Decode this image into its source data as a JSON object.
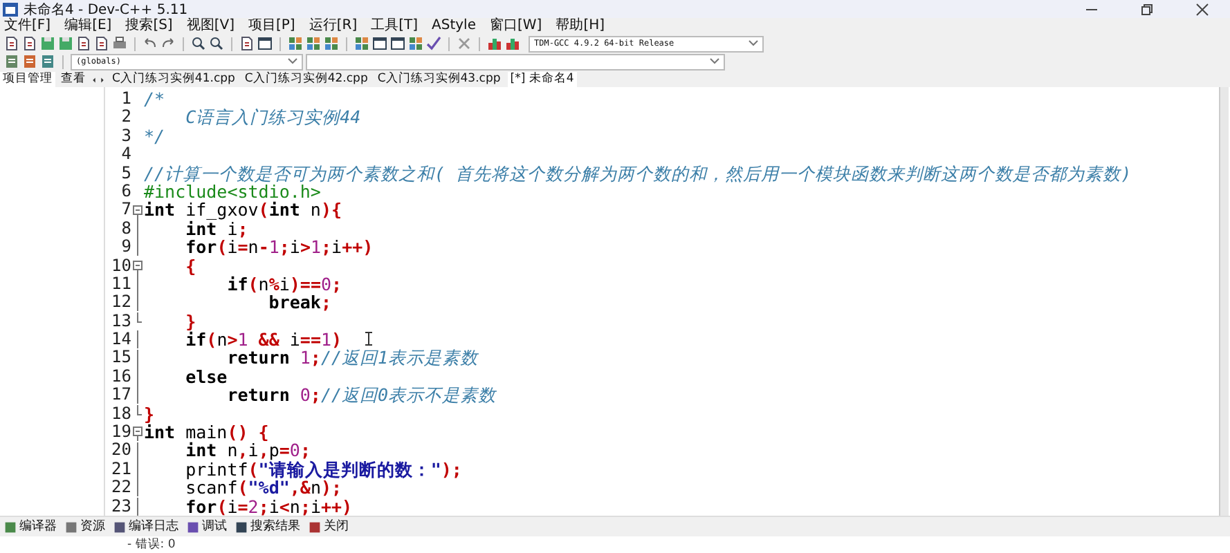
{
  "window": {
    "title": "未命名4 - Dev-C++ 5.11"
  },
  "menu": [
    "文件[F]",
    "编辑[E]",
    "搜索[S]",
    "视图[V]",
    "项目[P]",
    "运行[R]",
    "工具[T]",
    "AStyle",
    "窗口[W]",
    "帮助[H]"
  ],
  "compiler_select": {
    "value": "TDM-GCC 4.9.2 64-bit Release"
  },
  "scope_select": {
    "value": "(globals)"
  },
  "side_tabs": [
    {
      "label": "项目管理",
      "selected": true
    },
    {
      "label": "查看",
      "selected": false
    }
  ],
  "file_tabs": [
    {
      "label": "C入门练习实例41.cpp",
      "selected": false
    },
    {
      "label": "C入门练习实例42.cpp",
      "selected": false
    },
    {
      "label": "C入门练习实例43.cpp",
      "selected": false
    },
    {
      "label": "[*] 未命名4",
      "selected": true
    }
  ],
  "editor": {
    "lines": [
      {
        "number": "1",
        "kind": "plain",
        "tokens": [
          {
            "kind": "comment",
            "text": "/*"
          }
        ]
      },
      {
        "number": "2",
        "kind": "plain",
        "tokens": [
          {
            "kind": "comment",
            "text": "    C语言入门练习实例44"
          }
        ]
      },
      {
        "number": "3",
        "kind": "plain",
        "tokens": [
          {
            "kind": "comment",
            "text": "*/"
          }
        ]
      },
      {
        "number": "4",
        "kind": "plain"
      },
      {
        "number": "5",
        "kind": "plain",
        "tokens": [
          {
            "kind": "comment",
            "text": "//计算一个数是否可为两个素数之和( 首先将这个数分解为两个数的和，然后用一个模块函数来判断这两个数是否都为素数)"
          }
        ]
      },
      {
        "number": "6",
        "kind": "plain",
        "tokens": [
          {
            "kind": "preprocessor",
            "text": "#include<stdio.h>"
          }
        ]
      },
      {
        "number": "7",
        "kind": "start",
        "tokens": [
          {
            "kind": "keyword",
            "text": "int"
          },
          {
            "kind": "ident",
            "text": " if_gxov"
          },
          {
            "kind": "symbol",
            "text": "("
          },
          {
            "kind": "keyword",
            "text": "int"
          },
          {
            "kind": "ident",
            "text": " n"
          },
          {
            "kind": "symbol",
            "text": "){"
          }
        ]
      },
      {
        "number": "8",
        "kind": "body",
        "tokens": [
          {
            "kind": "keyword",
            "text": "    int"
          },
          {
            "kind": "ident",
            "text": " i"
          },
          {
            "kind": "symbol",
            "text": ";"
          }
        ]
      },
      {
        "number": "9",
        "kind": "body",
        "tokens": [
          {
            "kind": "keyword",
            "text": "    for"
          },
          {
            "kind": "symbol",
            "text": "("
          },
          {
            "kind": "ident",
            "text": "i"
          },
          {
            "kind": "symbol",
            "text": "="
          },
          {
            "kind": "ident",
            "text": "n"
          },
          {
            "kind": "symbol",
            "text": "-"
          },
          {
            "kind": "number",
            "text": "1"
          },
          {
            "kind": "symbol",
            "text": ";"
          },
          {
            "kind": "ident",
            "text": "i"
          },
          {
            "kind": "symbol",
            "text": ">"
          },
          {
            "kind": "number",
            "text": "1"
          },
          {
            "kind": "symbol",
            "text": ";"
          },
          {
            "kind": "ident",
            "text": "i"
          },
          {
            "kind": "symbol",
            "text": "++)"
          }
        ]
      },
      {
        "number": "10",
        "kind": "start",
        "tokens": [
          {
            "kind": "symbol",
            "text": "    {"
          }
        ]
      },
      {
        "number": "11",
        "kind": "body",
        "tokens": [
          {
            "kind": "keyword",
            "text": "        if"
          },
          {
            "kind": "symbol",
            "text": "("
          },
          {
            "kind": "ident",
            "text": "n"
          },
          {
            "kind": "symbol",
            "text": "%"
          },
          {
            "kind": "ident",
            "text": "i"
          },
          {
            "kind": "symbol",
            "text": ")=="
          },
          {
            "kind": "number",
            "text": "0"
          },
          {
            "kind": "symbol",
            "text": ";"
          }
        ]
      },
      {
        "number": "12",
        "kind": "body",
        "tokens": [
          {
            "kind": "keyword",
            "text": "            break"
          },
          {
            "kind": "symbol",
            "text": ";"
          }
        ]
      },
      {
        "number": "13",
        "kind": "end",
        "tokens": [
          {
            "kind": "symbol",
            "text": "    }"
          }
        ]
      },
      {
        "number": "14",
        "kind": "body",
        "tokens": [
          {
            "kind": "keyword",
            "text": "    if"
          },
          {
            "kind": "symbol",
            "text": "("
          },
          {
            "kind": "ident",
            "text": "n"
          },
          {
            "kind": "symbol",
            "text": ">"
          },
          {
            "kind": "number",
            "text": "1"
          },
          {
            "kind": "symbol",
            "text": " && "
          },
          {
            "kind": "ident",
            "text": "i"
          },
          {
            "kind": "symbol",
            "text": "=="
          },
          {
            "kind": "number",
            "text": "1"
          },
          {
            "kind": "symbol",
            "text": ")"
          }
        ]
      },
      {
        "number": "15",
        "kind": "body",
        "tokens": [
          {
            "kind": "keyword",
            "text": "        return"
          },
          {
            "kind": "number",
            "text": " 1"
          },
          {
            "kind": "symbol",
            "text": ";"
          },
          {
            "kind": "comment",
            "text": "//返回1表示是素数"
          }
        ]
      },
      {
        "number": "16",
        "kind": "body",
        "tokens": [
          {
            "kind": "keyword",
            "text": "    else"
          }
        ]
      },
      {
        "number": "17",
        "kind": "body",
        "tokens": [
          {
            "kind": "keyword",
            "text": "        return"
          },
          {
            "kind": "number",
            "text": " 0"
          },
          {
            "kind": "symbol",
            "text": ";"
          },
          {
            "kind": "comment",
            "text": "//返回0表示不是素数"
          }
        ]
      },
      {
        "number": "18",
        "kind": "end",
        "tokens": [
          {
            "kind": "symbol",
            "text": "}"
          }
        ]
      },
      {
        "number": "19",
        "kind": "start",
        "tokens": [
          {
            "kind": "keyword",
            "text": "int"
          },
          {
            "kind": "ident",
            "text": " main"
          },
          {
            "kind": "symbol",
            "text": "() {"
          }
        ]
      },
      {
        "number": "20",
        "kind": "body",
        "tokens": [
          {
            "kind": "keyword",
            "text": "    int"
          },
          {
            "kind": "ident",
            "text": " n"
          },
          {
            "kind": "symbol",
            "text": ","
          },
          {
            "kind": "ident",
            "text": "i"
          },
          {
            "kind": "symbol",
            "text": ","
          },
          {
            "kind": "ident",
            "text": "p"
          },
          {
            "kind": "symbol",
            "text": "="
          },
          {
            "kind": "number",
            "text": "0"
          },
          {
            "kind": "symbol",
            "text": ";"
          }
        ]
      },
      {
        "number": "21",
        "kind": "body",
        "tokens": [
          {
            "kind": "ident",
            "text": "    printf"
          },
          {
            "kind": "symbol",
            "text": "("
          },
          {
            "kind": "string",
            "text": "\"请输入是判断的数：\""
          },
          {
            "kind": "symbol",
            "text": ");"
          }
        ]
      },
      {
        "number": "22",
        "kind": "body",
        "tokens": [
          {
            "kind": "ident",
            "text": "    scanf"
          },
          {
            "kind": "symbol",
            "text": "("
          },
          {
            "kind": "string",
            "text": "\"%d\""
          },
          {
            "kind": "symbol",
            "text": ",&"
          },
          {
            "kind": "ident",
            "text": "n"
          },
          {
            "kind": "symbol",
            "text": ");"
          }
        ]
      },
      {
        "number": "23",
        "kind": "body",
        "tokens": [
          {
            "kind": "keyword",
            "text": "    for"
          },
          {
            "kind": "symbol",
            "text": "("
          },
          {
            "kind": "ident",
            "text": "i"
          },
          {
            "kind": "symbol",
            "text": "="
          },
          {
            "kind": "number",
            "text": "2"
          },
          {
            "kind": "symbol",
            "text": ";"
          },
          {
            "kind": "ident",
            "text": "i"
          },
          {
            "kind": "symbol",
            "text": "<"
          },
          {
            "kind": "ident",
            "text": "n"
          },
          {
            "kind": "symbol",
            "text": ";"
          },
          {
            "kind": "ident",
            "text": "i"
          },
          {
            "kind": "symbol",
            "text": "++)"
          }
        ]
      }
    ]
  },
  "bottom_tabs": [
    "编译器",
    "资源",
    "编译日志",
    "调试",
    "搜索结果",
    "关闭"
  ],
  "log_line": "- 错误: 0"
}
